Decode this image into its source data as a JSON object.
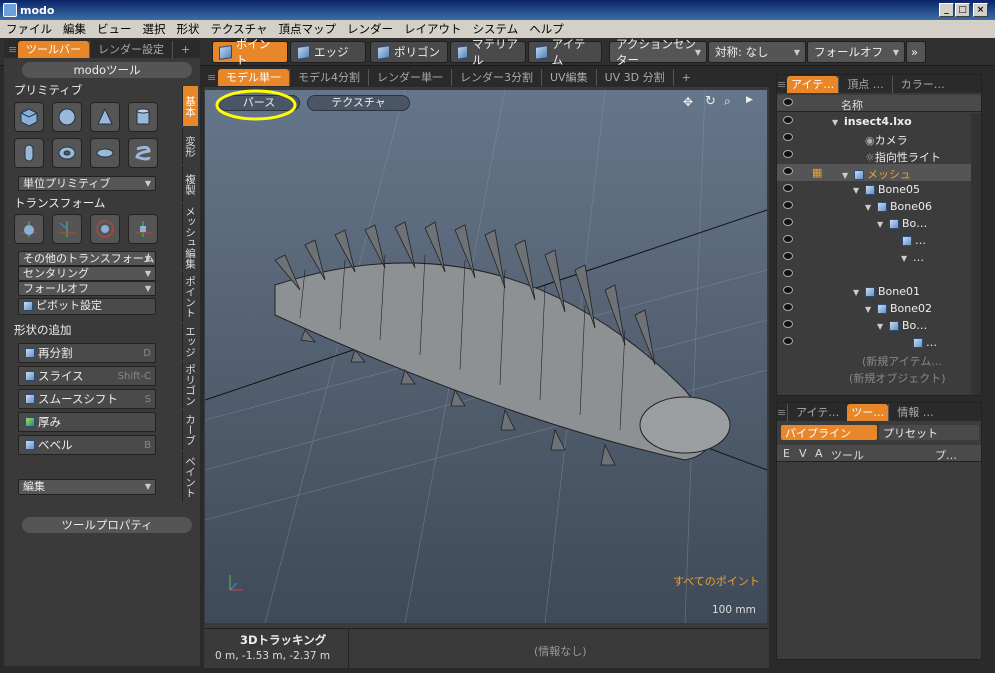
{
  "window": {
    "title": "modo",
    "min": "_",
    "max": "□",
    "close": "×"
  },
  "menu": [
    "ファイル",
    "編集",
    "ビュー",
    "選択",
    "形状",
    "テクスチャ",
    "頂点マップ",
    "レンダー",
    "レイアウト",
    "システム",
    "ヘルプ"
  ],
  "left_tabs": {
    "active": "ツールバー",
    "other": "レンダー設定",
    "plus": "+"
  },
  "toolbox": {
    "header": "modoツール",
    "primitive_title": "プリミティブ",
    "unit_primitive": "単位プリミティブ",
    "transform_title": "トランスフォーム",
    "other_transform": "その他のトランスフォーム",
    "centering": "センタリング",
    "falloff": "フォールオフ",
    "pivot": "ピボット設定",
    "add_shape_title": "形状の追加",
    "tools": [
      {
        "label": "再分割",
        "shortcut": "D"
      },
      {
        "label": "スライス",
        "shortcut": "Shift-C"
      },
      {
        "label": "スムースシフト",
        "shortcut": "S"
      },
      {
        "label": "厚み",
        "shortcut": ""
      },
      {
        "label": "ベベル",
        "shortcut": "B"
      }
    ],
    "edit": "編集",
    "tool_props": "ツールプロパティ"
  },
  "vertical_tabs": [
    "基本",
    "変形",
    "複製",
    "メッシュ編集",
    "ポイント",
    "エッジ",
    "ポリゴン",
    "カーブ",
    "ペイント"
  ],
  "modes": [
    "ポイント",
    "エッジ",
    "ポリゴン",
    "マテリアル",
    "アイテム"
  ],
  "action_center": "アクションセンター",
  "symmetry": "対称: なし",
  "falloff_off": "フォールオフ",
  "more": "»",
  "viewport_tabs": [
    "モデル単一",
    "モデル4分割",
    "レンダー単一",
    "レンダー3分割",
    "UV編集",
    "UV 3D 分割"
  ],
  "viewport": {
    "view_label": "パース",
    "texture_label": "テクスチャ",
    "mode_text": "すべてのポイント",
    "scale": "100 mm"
  },
  "status": {
    "title": "3Dトラッキング",
    "coords": "0 m, -1.53 m, -2.37 m",
    "info": "(情報なし)"
  },
  "items_panel": {
    "tabs": [
      "アイテ…",
      "頂点 …",
      "カラー…"
    ],
    "name_col": "名称",
    "rows": [
      {
        "label": "insect4.lxo"
      },
      {
        "label": "カメラ"
      },
      {
        "label": "指向性ライト"
      },
      {
        "label": "メッシュ"
      },
      {
        "label": "Bone05"
      },
      {
        "label": "Bone06"
      },
      {
        "label": "Bo…"
      },
      {
        "label": "…"
      },
      {
        "label": "…"
      },
      {
        "label": ""
      },
      {
        "label": "Bone01"
      },
      {
        "label": "Bone02"
      },
      {
        "label": "Bo…"
      },
      {
        "label": "…"
      },
      {
        "label": "(新規アイテム…"
      },
      {
        "label": "(新規オブジェクト)"
      }
    ]
  },
  "tool_panel": {
    "tabs": [
      "アイテ…",
      "ツー…",
      "情報 …"
    ],
    "pipeline": "パイプライン",
    "preset": "プリセット",
    "cols": [
      "E",
      "V",
      "A",
      "ツール",
      "プ…"
    ]
  }
}
